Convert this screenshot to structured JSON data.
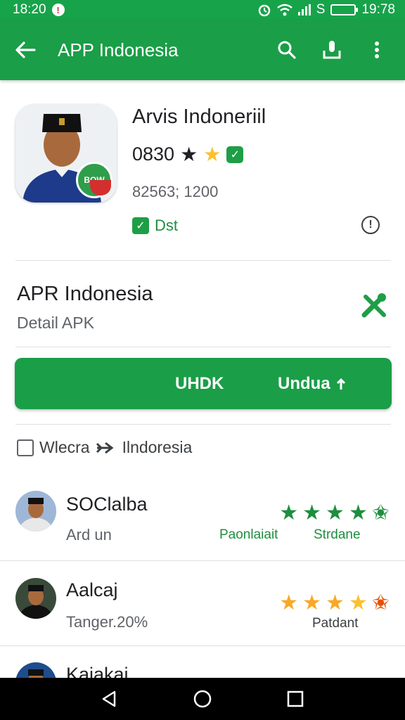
{
  "status_bar": {
    "time_left": "18:20",
    "notif_glyph": "!",
    "sim_label": "S",
    "time_right": "19:78"
  },
  "app_bar": {
    "title": "APP Indonesia",
    "icons": [
      "back-arrow-icon",
      "search-icon",
      "download-icon",
      "more-vert-icon"
    ]
  },
  "header": {
    "app_name": "Arvis Indoneriil",
    "rating_text": "0830",
    "downloads": "82563; 1200",
    "tag": "Dst",
    "icon_badge": "BOW"
  },
  "sub_header": {
    "title": "APR Indonesia",
    "caption": "Detail APK"
  },
  "install_button": {
    "label_left": "UHDK",
    "label_right": "Undua"
  },
  "language_row": {
    "label_left": "Wlecra",
    "label_right": "Ilndoresia"
  },
  "reviews": [
    {
      "name": "SOClalba",
      "sub": "Ard un",
      "stars": 5,
      "label_left": "Paonlaiait",
      "label_right": "Strdane",
      "star_color": "#1e8e3e"
    },
    {
      "name": "Aalcaj",
      "sub": "Tanger.20%",
      "stars": 4.5,
      "label_right": "Patdant",
      "star_color": "#f9a825"
    },
    {
      "name": "Kaiakai",
      "sub": ""
    }
  ],
  "colors": {
    "brand_green": "#1a9e47",
    "star_gold": "#fbc02d"
  }
}
